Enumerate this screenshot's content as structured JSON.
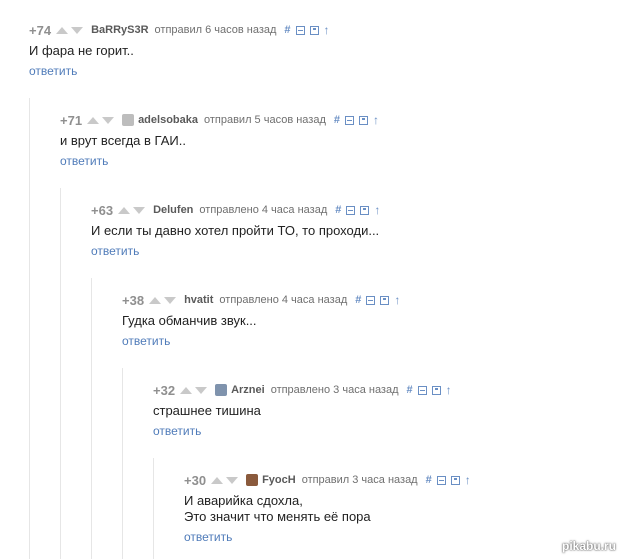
{
  "comments": [
    {
      "rating": "+74",
      "author": "BaRRyS3R",
      "meta": "отправил 6 часов назад",
      "text": "И фара не горит..",
      "reply": "ответить",
      "avatar": null
    },
    {
      "rating": "+71",
      "author": "adelsobaka",
      "meta": "отправил 5 часов назад",
      "text": "и врут всегда в ГАИ..",
      "reply": "ответить",
      "avatar": "#bdbdbd"
    },
    {
      "rating": "+63",
      "author": "Delufen",
      "meta": "отправлено 4 часа назад",
      "text": "И если ты давно хотел пройти ТО, то проходи...",
      "reply": "ответить",
      "avatar": null
    },
    {
      "rating": "+38",
      "author": "hvatit",
      "meta": "отправлено 4 часа назад",
      "text": "Гудка обманчив звук...",
      "reply": "ответить",
      "avatar": null
    },
    {
      "rating": "+32",
      "author": "Arznei",
      "meta": "отправлено 3 часа назад",
      "text": "страшнее тишина",
      "reply": "ответить",
      "avatar": "#7f93ad"
    },
    {
      "rating": "+30",
      "author": "FyocH",
      "meta": "отправил 3 часа назад",
      "text": "И аварийка сдохла,\nЭто значит что менять её пора",
      "reply": "ответить",
      "avatar": "#8a5a3c"
    }
  ],
  "tools": {
    "hash": "#",
    "arrow": "↑"
  },
  "watermark": "pikabu.ru"
}
